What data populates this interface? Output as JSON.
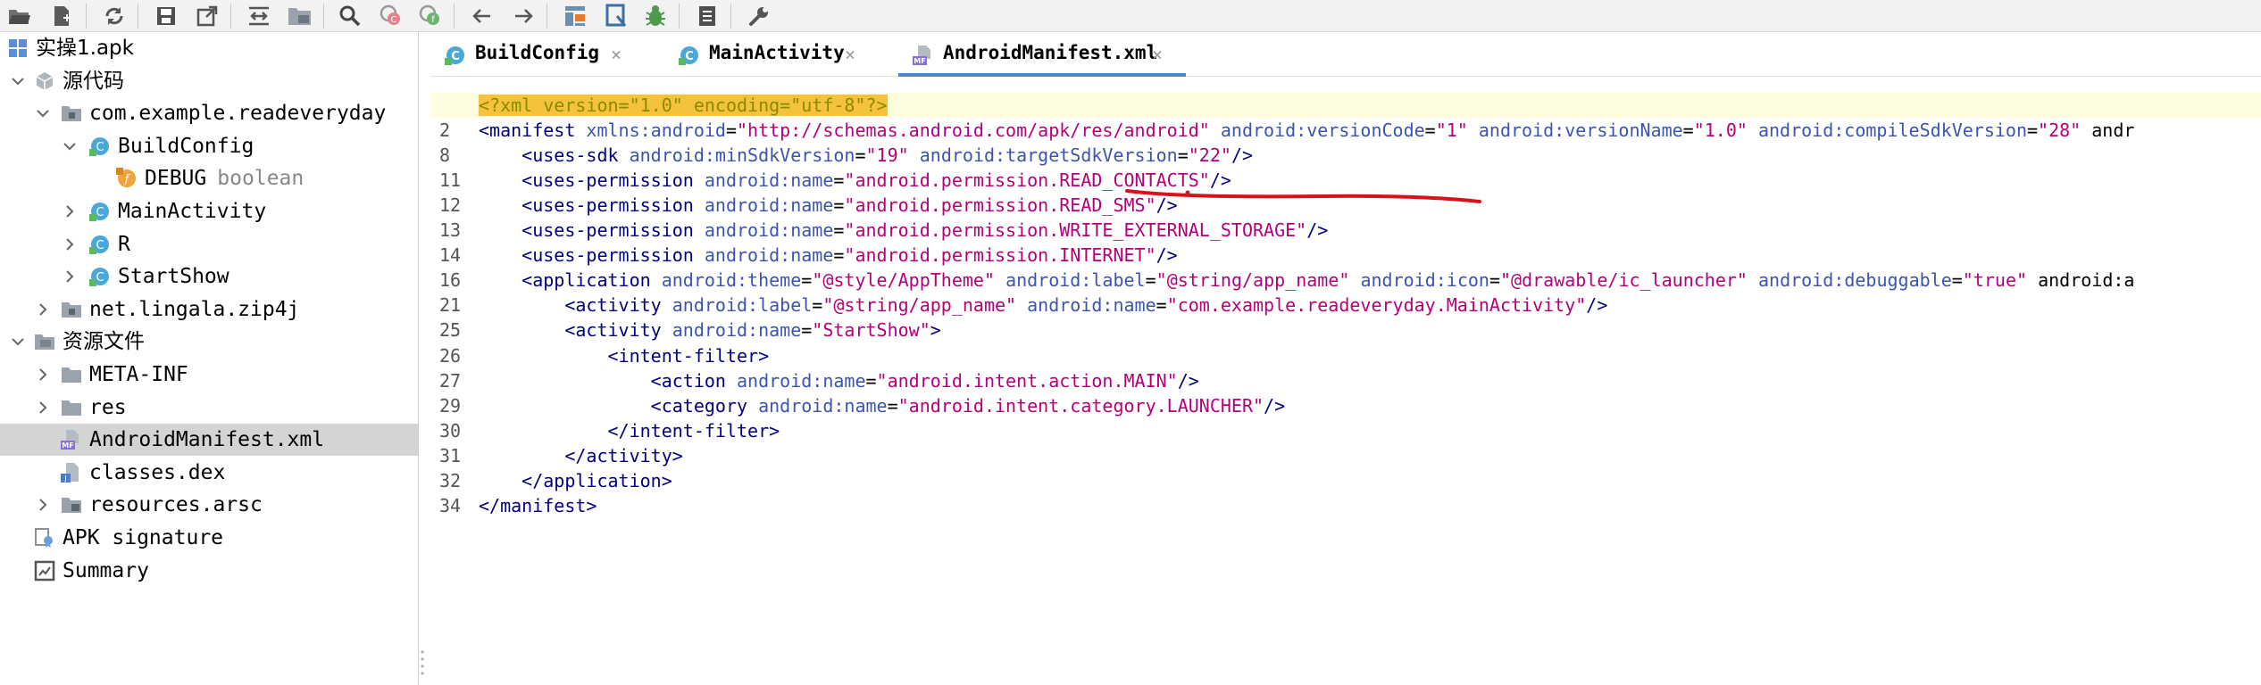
{
  "toolbar": {
    "buttons": [
      {
        "icon": "open-folder-icon"
      },
      {
        "icon": "add-file-icon"
      },
      {
        "icon": "refresh-icon"
      },
      {
        "icon": "save-icon"
      },
      {
        "icon": "export-icon"
      },
      {
        "icon": "sync-editor-icon"
      },
      {
        "icon": "folder-view-icon"
      },
      {
        "icon": "search-icon"
      },
      {
        "icon": "find-class-icon"
      },
      {
        "icon": "find-usage-icon"
      },
      {
        "icon": "back-arrow-icon"
      },
      {
        "icon": "forward-arrow-icon"
      },
      {
        "icon": "decompile-icon"
      },
      {
        "icon": "deobfuscation-icon"
      },
      {
        "icon": "debug-bug-icon"
      },
      {
        "icon": "log-icon"
      },
      {
        "icon": "wrench-icon"
      }
    ]
  },
  "tree": {
    "items": [
      {
        "label": "实操1.apk",
        "icon": "apk-icon",
        "arrow": "none"
      },
      {
        "label": "源代码",
        "icon": "source-package-icon",
        "arrow": "down"
      },
      {
        "label": "com.example.readeveryday",
        "icon": "package-icon",
        "arrow": "down"
      },
      {
        "label": "BuildConfig",
        "icon": "class-icon",
        "arrow": "down"
      },
      {
        "label": "DEBUG",
        "type": "boolean",
        "icon": "field-icon",
        "arrow": "none"
      },
      {
        "label": "MainActivity",
        "icon": "class-icon",
        "arrow": "right"
      },
      {
        "label": "R",
        "icon": "class-icon",
        "arrow": "right"
      },
      {
        "label": "StartShow",
        "icon": "class-icon",
        "arrow": "right"
      },
      {
        "label": "net.lingala.zip4j",
        "icon": "package-icon",
        "arrow": "right"
      },
      {
        "label": "资源文件",
        "icon": "resources-folder-icon",
        "arrow": "down"
      },
      {
        "label": "META-INF",
        "icon": "folder-icon",
        "arrow": "right"
      },
      {
        "label": "res",
        "icon": "folder-icon",
        "arrow": "right"
      },
      {
        "label": "AndroidManifest.xml",
        "icon": "manifest-file-icon",
        "arrow": "none",
        "selected": true
      },
      {
        "label": "classes.dex",
        "icon": "dex-file-icon",
        "arrow": "none"
      },
      {
        "label": "resources.arsc",
        "icon": "arsc-file-icon",
        "arrow": "right"
      },
      {
        "label": "APK signature",
        "icon": "certificate-icon",
        "arrow": "none"
      },
      {
        "label": "Summary",
        "icon": "summary-icon",
        "arrow": "none"
      }
    ]
  },
  "tabs": [
    {
      "label": "BuildConfig",
      "icon": "class-icon",
      "close": "×"
    },
    {
      "label": "MainActivity",
      "icon": "class-icon",
      "close": "×"
    },
    {
      "label": "AndroidManifest.xml",
      "icon": "manifest-file-icon",
      "close": "×",
      "active": true
    }
  ],
  "editor": {
    "lines": [
      {
        "num": "",
        "text": "<?xml version=\"1.0\" encoding=\"utf-8\"?>"
      },
      {
        "num": "2",
        "text": "<manifest xmlns:android=\"http://schemas.android.com/apk/res/android\" android:versionCode=\"1\" android:versionName=\"1.0\" android:compileSdkVersion=\"28\" andr"
      },
      {
        "num": "8",
        "text": "    <uses-sdk android:minSdkVersion=\"19\" android:targetSdkVersion=\"22\"/>"
      },
      {
        "num": "11",
        "text": "    <uses-permission android:name=\"android.permission.READ_CONTACTS\"/>"
      },
      {
        "num": "12",
        "text": "    <uses-permission android:name=\"android.permission.READ_SMS\"/>"
      },
      {
        "num": "13",
        "text": "    <uses-permission android:name=\"android.permission.WRITE_EXTERNAL_STORAGE\"/>"
      },
      {
        "num": "14",
        "text": "    <uses-permission android:name=\"android.permission.INTERNET\"/>"
      },
      {
        "num": "16",
        "text": "    <application android:theme=\"@style/AppTheme\" android:label=\"@string/app_name\" android:icon=\"@drawable/ic_launcher\" android:debuggable=\"true\" android:a"
      },
      {
        "num": "21",
        "text": "        <activity android:label=\"@string/app_name\" android:name=\"com.example.readeveryday.MainActivity\"/>"
      },
      {
        "num": "25",
        "text": "        <activity android:name=\"StartShow\">"
      },
      {
        "num": "26",
        "text": "            <intent-filter>"
      },
      {
        "num": "27",
        "text": "                <action android:name=\"android.intent.action.MAIN\"/>"
      },
      {
        "num": "29",
        "text": "                <category android:name=\"android.intent.category.LAUNCHER\"/>"
      },
      {
        "num": "30",
        "text": "            </intent-filter>"
      },
      {
        "num": "31",
        "text": "        </activity>"
      },
      {
        "num": "32",
        "text": "    </application>"
      },
      {
        "num": "34",
        "text": "</manifest>"
      }
    ]
  },
  "colors": {
    "annotation_red": "#d9111a",
    "selected_row": "#d4d4d4",
    "active_tab_underline": "#4a88c7",
    "xml_decl_highlight": "#f5c33b"
  }
}
